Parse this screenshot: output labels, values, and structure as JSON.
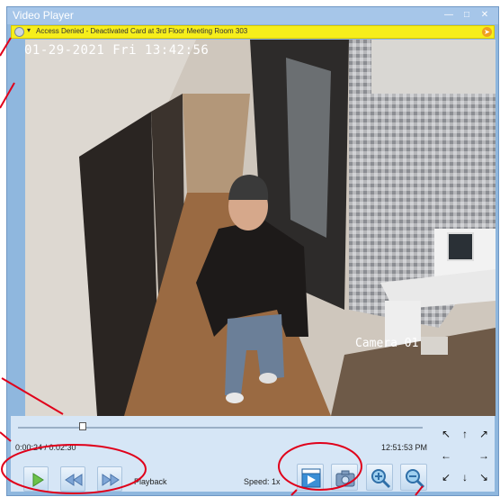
{
  "window": {
    "title": "Video Player",
    "minimize_icon": "minimize-icon",
    "maximize_icon": "maximize-icon",
    "close_icon": "close-icon"
  },
  "alert": {
    "text": "Access Denied - Deactivated Card at 3rd Floor Meeting Room 303",
    "icon": "alarm-icon",
    "close_icon": "dismiss-icon",
    "color": "#f6ee1b"
  },
  "video": {
    "timestamp": "01-29-2021 Fri 13:42:56",
    "camera_label": "Camera 01"
  },
  "playback": {
    "position": "0:00:24 / 0:02:30",
    "clock": "12:51:53 PM",
    "progress_fraction": 0.16,
    "label": "Playback",
    "speed_label": "Speed: 1x"
  },
  "icons": {
    "play": "play-icon",
    "rewind": "rewind-icon",
    "fast_forward": "fast-forward-icon",
    "export": "export-clip-icon",
    "snapshot": "camera-snapshot-icon",
    "zoom_in": "zoom-in-icon",
    "zoom_out": "zoom-out-icon"
  },
  "ptz": [
    "up-left",
    "up",
    "up-right",
    "left",
    "right",
    "down-left",
    "down",
    "down-right"
  ],
  "colors": {
    "accent": "#8fb7de",
    "annotation": "#e0001a"
  }
}
